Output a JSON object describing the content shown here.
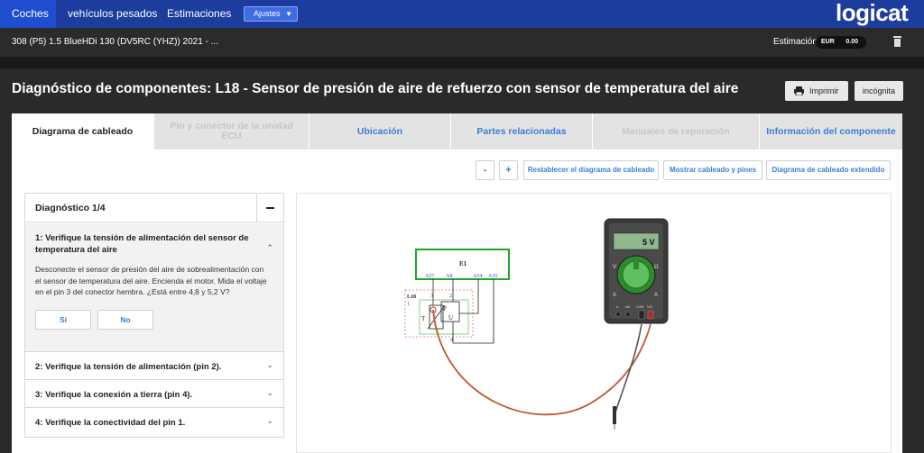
{
  "nav": {
    "tabs": [
      "Coches",
      "vehículos pesados",
      "Estimaciones"
    ],
    "settings_label": "Ajustes",
    "logo": "logicat"
  },
  "vehicle": {
    "title": "308 (P5) 1.5 BlueHDi 130 (DV5RC (YHZ)) 2021 - ...",
    "estimate_label": "Estimación",
    "currency": "EUR",
    "amount": "0.00"
  },
  "page": {
    "title": "Diagnóstico de componentes: L18 - Sensor de presión de aire de refuerzo con sensor de temperatura del aire",
    "print_label": "Imprimir",
    "incognito_label": "incógnita"
  },
  "tabs": [
    {
      "label": "Diagrama de cableado",
      "state": "active"
    },
    {
      "label": "Pin y conector de la unidad ECU",
      "state": "disabled"
    },
    {
      "label": "Ubicación",
      "state": "enabled"
    },
    {
      "label": "Partes relacionadas",
      "state": "enabled"
    },
    {
      "label": "Manuales de reparación",
      "state": "disabled"
    },
    {
      "label": "Información del componente",
      "state": "enabled"
    }
  ],
  "toolbar": {
    "zoom_out": "-",
    "zoom_in": "+",
    "reset": "Restablecer el diagrama de cableado",
    "show_pins": "Mostrar cableado y pines",
    "extended": "Diagrama de cableado extendido"
  },
  "diagnosis": {
    "header": "Diagnóstico 1/4",
    "steps": [
      {
        "title": "1: Verifique la tensión de alimentación del sensor de temperatura del aire",
        "description": "Desconecte el sensor de presión del aire de sobrealimentación con el sensor de temperatura del aire. Encienda el motor. Mida el voltaje en el pin 3 del conector hembra. ¿Está entre 4,8 y 5,2 V?",
        "yes": "Sí",
        "no": "No"
      },
      {
        "title": "2: Verifique la tensión de alimentación (pin 2)."
      },
      {
        "title": "3: Verifique la conexión a tierra (pin 4)."
      },
      {
        "title": "4: Verifique la conectividad del pin 1."
      }
    ]
  },
  "diagram": {
    "ecu_label": "E1",
    "ecu_pins": [
      "A57",
      "A8",
      "A54",
      "A35"
    ],
    "sensor_label": "L18",
    "sensor_pins": [
      "1",
      "3",
      "2",
      "4"
    ],
    "sensor_symbols": [
      "T",
      "P",
      "U"
    ],
    "meter_reading": "5 V",
    "meter_dial_letters": [
      "V",
      "Ω",
      "A",
      "A"
    ],
    "meter_port_labels": [
      "A",
      "mA",
      "COM",
      "V/Ω"
    ]
  },
  "colors": {
    "nav_bg": "#1c3d9e",
    "accent": "#3b7fd6",
    "ecu_green": "#22a52b",
    "probe_red": "#c0562f"
  }
}
